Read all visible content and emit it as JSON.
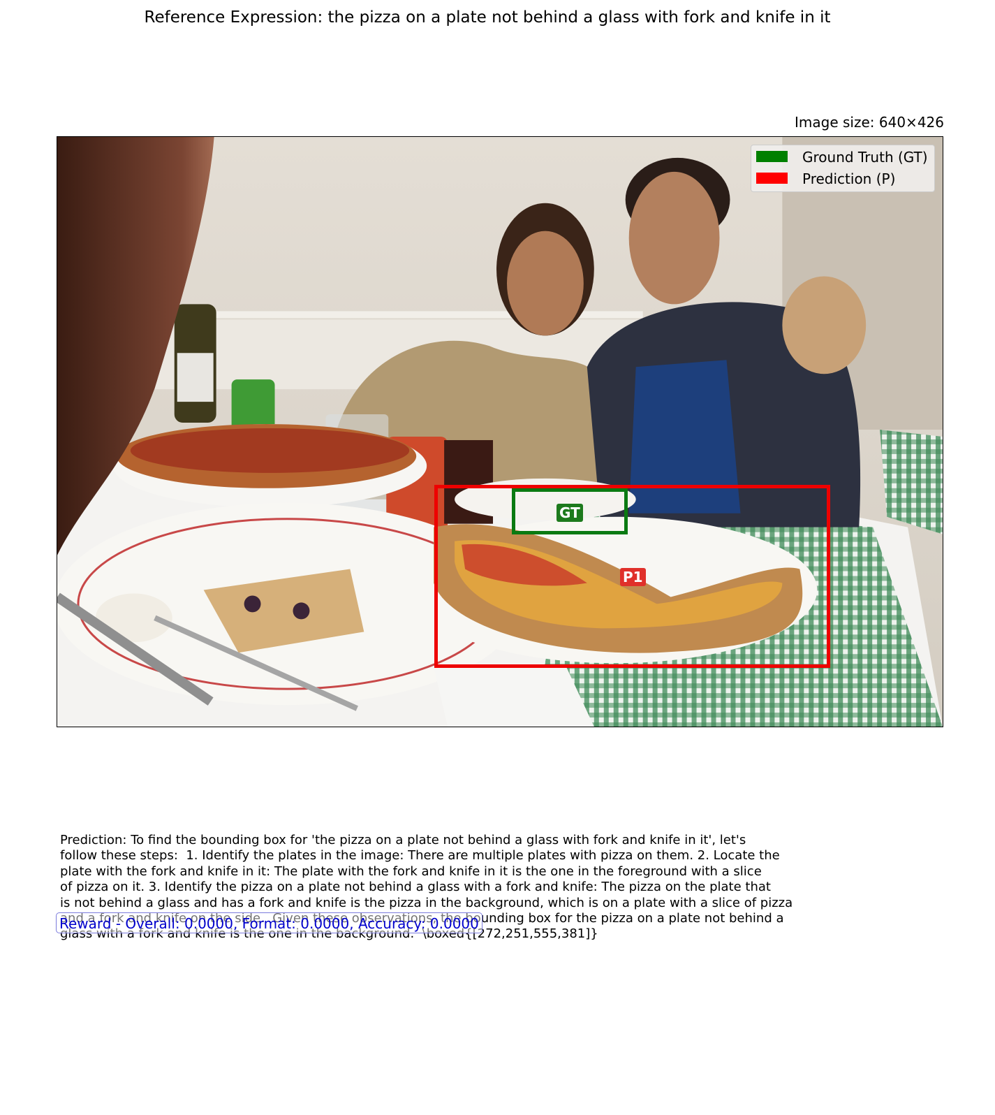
{
  "header": {
    "title": "Reference Expression: the pizza on a plate not behind a glass with fork and knife in it",
    "image_size": "Image size: 640×426"
  },
  "legend": {
    "gt_label": "Ground Truth (GT)",
    "pred_label": "Prediction (P)",
    "gt_color": "#008000",
    "pred_color": "#ff0000"
  },
  "boxes": {
    "gt_tag": "GT",
    "pred_tag": "P1"
  },
  "prediction": {
    "text": "Prediction: To find the bounding box for 'the pizza on a plate not behind a glass with fork and knife in it', let's\nfollow these steps:  1. Identify the plates in the image: There are multiple plates with pizza on them. 2. Locate the\nplate with the fork and knife in it: The plate with the fork and knife in it is the one in the foreground with a slice\nof pizza on it. 3. Identify the pizza on a plate not behind a glass with a fork and knife: The pizza on the plate that\nis not behind a glass and has a fork and knife is the pizza in the background, which is on a plate with a slice of pizza\nand a fork and knife on the side.  Given these observations, the bounding box for the pizza on a plate not behind a\nglass with a fork and knife is the one in the background.  \\boxed{[272,251,555,381]}"
  },
  "reward": {
    "text": "Reward - Overall: 0.0000, Format: 0.0000, Accuracy: 0.0000"
  }
}
